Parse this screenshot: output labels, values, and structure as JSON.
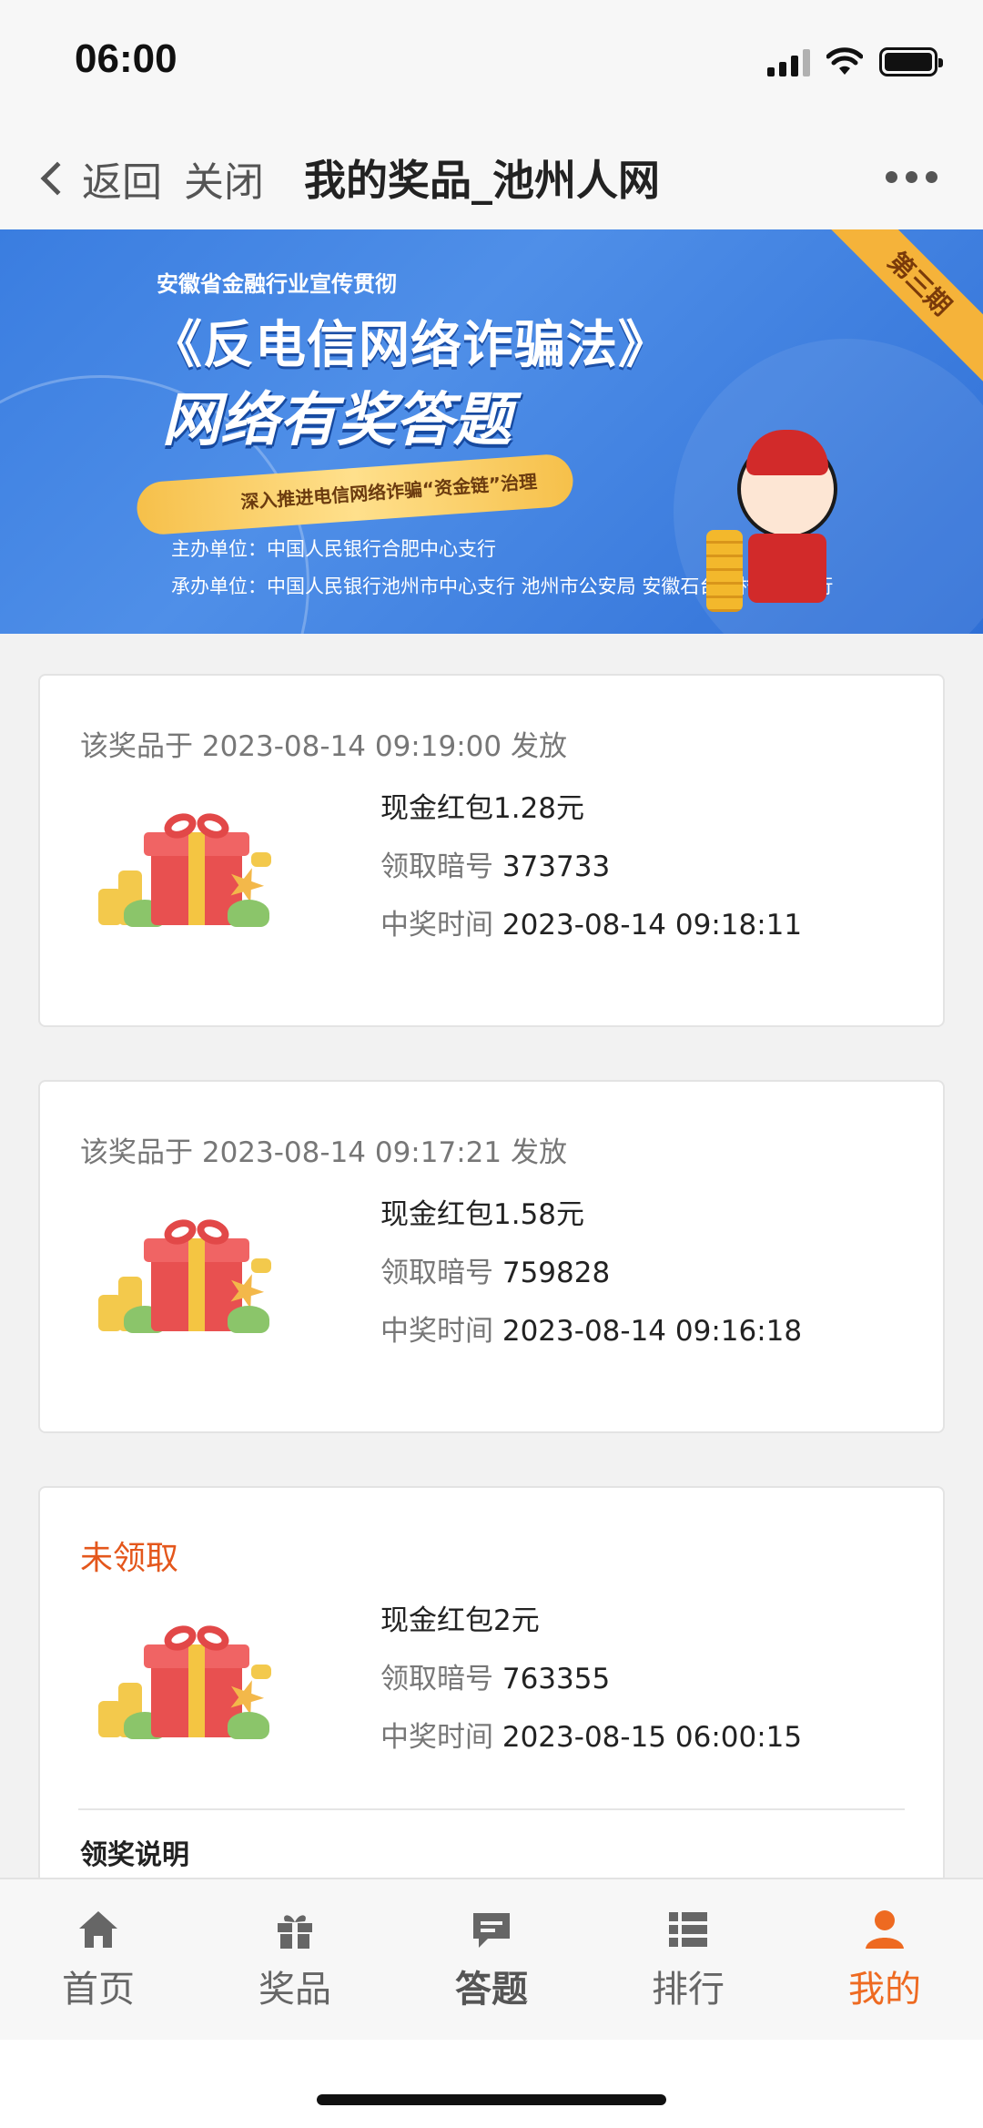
{
  "status_bar": {
    "time": "06:00"
  },
  "nav": {
    "back_label": "返回",
    "close_label": "关闭",
    "title": "我的奖品_池州人网"
  },
  "banner": {
    "subtitle": "安徽省金融行业宣传贯彻",
    "title": "《反电信网络诈骗法》",
    "quiz_title": "网络有奖答题",
    "ribbon_text": "深入推进电信网络诈骗“资金链”治理",
    "host": "主办单位：中国人民银行合肥中心支行",
    "organizers": "承办单位：中国人民银行池州市中心支行  池州市公安局  安徽石台农村商业银行",
    "corner": "第三期"
  },
  "prizes": [
    {
      "header": "该奖品于 2023-08-14 09:19:00 发放",
      "name": "现金红包1.28元",
      "code_label": "领取暗号",
      "code": "373733",
      "time_label": "中奖时间",
      "time": "2023-08-14 09:18:11"
    },
    {
      "header": "该奖品于 2023-08-14 09:17:21 发放",
      "name": "现金红包1.58元",
      "code_label": "领取暗号",
      "code": "759828",
      "time_label": "中奖时间",
      "time": "2023-08-14 09:16:18"
    },
    {
      "header": "未领取",
      "name": "现金红包2元",
      "code_label": "领取暗号",
      "code": "763355",
      "time_label": "中奖时间",
      "time": "2023-08-15 06:00:15",
      "note_title": "领奖说明"
    }
  ],
  "tabs": [
    {
      "label": "首页",
      "icon": "home-icon"
    },
    {
      "label": "奖品",
      "icon": "gift-icon"
    },
    {
      "label": "答题",
      "icon": "chat-icon"
    },
    {
      "label": "排行",
      "icon": "list-icon"
    },
    {
      "label": "我的",
      "icon": "user-icon",
      "active": true
    }
  ],
  "colors": {
    "accent": "#ee6a21",
    "unclaimed": "#e4571c",
    "banner": "#3a7de0"
  }
}
